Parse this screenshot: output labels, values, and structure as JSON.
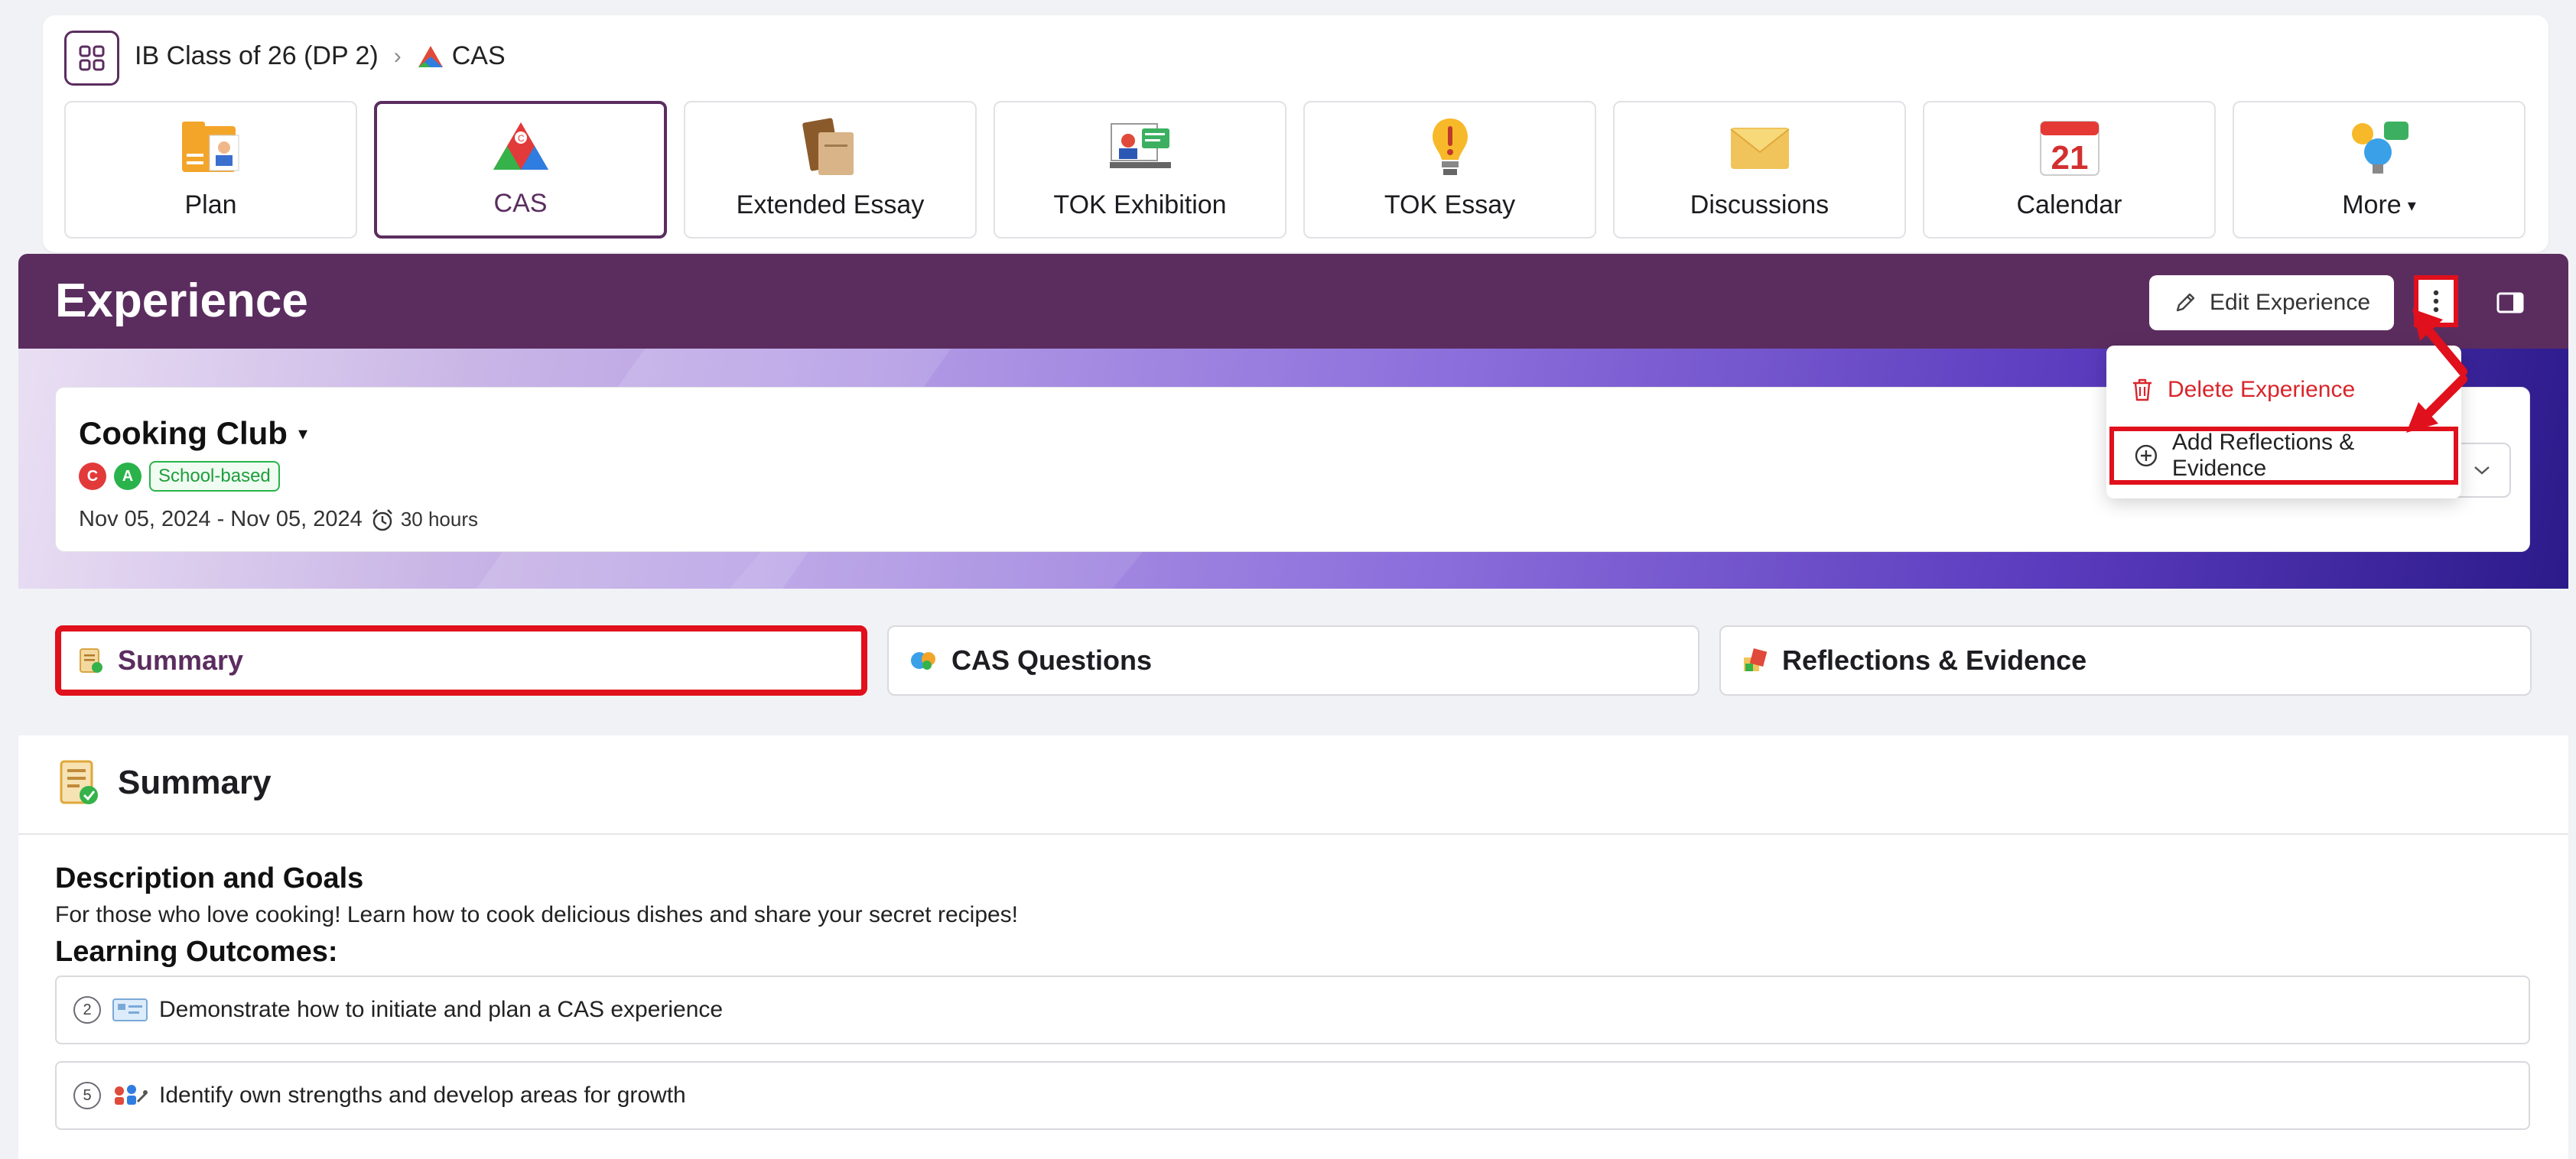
{
  "breadcrumb": {
    "class_name": "IB Class of 26 (DP 2)",
    "current": "CAS"
  },
  "tiles": [
    {
      "label": "Plan",
      "icon": "plan-icon"
    },
    {
      "label": "CAS",
      "icon": "cas-icon",
      "active": true
    },
    {
      "label": "Extended Essay",
      "icon": "extended-essay-icon"
    },
    {
      "label": "TOK Exhibition",
      "icon": "tok-exhibition-icon"
    },
    {
      "label": "TOK Essay",
      "icon": "tok-essay-icon"
    },
    {
      "label": "Discussions",
      "icon": "discussions-icon"
    },
    {
      "label": "Calendar",
      "icon": "calendar-icon",
      "day": "21"
    },
    {
      "label": "More",
      "icon": "more-icon"
    }
  ],
  "header": {
    "title": "Experience",
    "edit_label": "Edit Experience"
  },
  "experience": {
    "name": "Cooking Club",
    "strand_c": "C",
    "strand_a": "A",
    "badge": "School-based",
    "dates": "Nov 05, 2024 - Nov 05, 2024",
    "hours": "30 hours"
  },
  "menu": {
    "delete_label": "Delete Experience",
    "add_label": "Add Reflections & Evidence"
  },
  "tabs": [
    {
      "label": "Summary",
      "active": true
    },
    {
      "label": "CAS Questions"
    },
    {
      "label": "Reflections & Evidence"
    }
  ],
  "summary": {
    "heading": "Summary",
    "desc_title": "Description and Goals",
    "desc_text": "For those who love cooking! Learn how to cook delicious dishes and share your secret recipes!",
    "lo_title": "Learning Outcomes:",
    "outcomes": [
      {
        "num": "2",
        "text": "Demonstrate how to initiate and plan a CAS experience"
      },
      {
        "num": "5",
        "text": "Identify own strengths and develop areas for growth"
      }
    ]
  },
  "colors": {
    "brand": "#5b2d5f",
    "highlight": "#e0101c",
    "danger": "#d9252b",
    "success": "#29b34a"
  }
}
